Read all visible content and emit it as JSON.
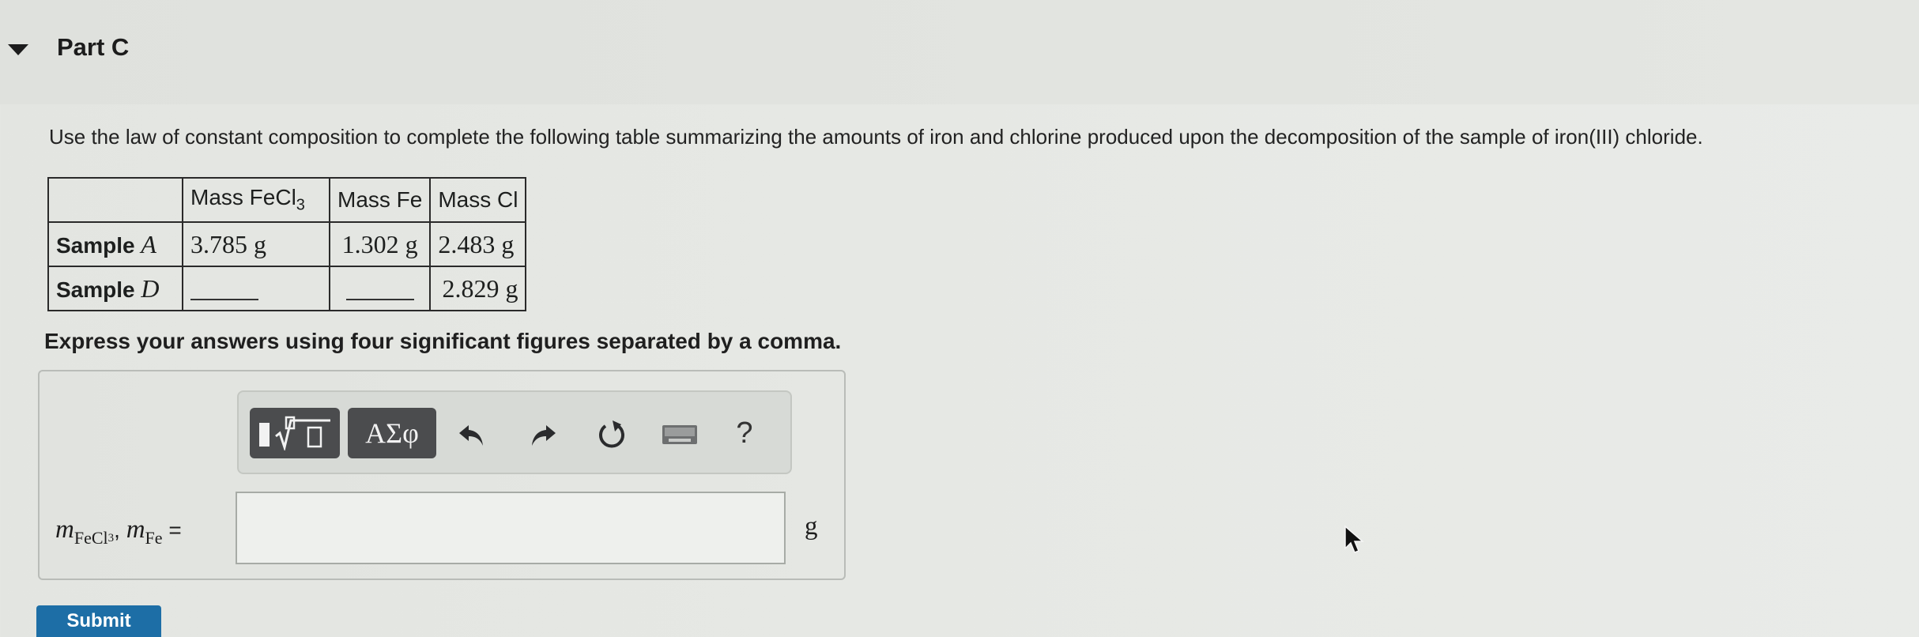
{
  "part": {
    "title": "Part C"
  },
  "question": {
    "instructions": "Use the law of constant composition to complete the following table summarizing the amounts of iron and chlorine produced upon the decomposition of the sample of iron(III) chloride.",
    "table": {
      "headers": [
        "",
        "Mass FeCl",
        "Mass Fe",
        "Mass Cl"
      ],
      "header_subscript": "3",
      "rows": [
        {
          "label": "Sample ",
          "label_var": "A",
          "values": [
            "3.785 g",
            "1.302 g",
            "2.483 g"
          ]
        },
        {
          "label": "Sample ",
          "label_var": "D",
          "values": [
            "",
            "",
            "2.829 g"
          ]
        }
      ]
    },
    "note": "Express your answers using four significant figures separated by a comma."
  },
  "answer": {
    "label_m1": "m",
    "label_sub1": "FeCl",
    "label_sub1_3": "3",
    "label_sep": ", ",
    "label_m2": "m",
    "label_sub2": "Fe",
    "label_eq": " =",
    "input_value": "",
    "unit": "g"
  },
  "toolbar": {
    "greek_label": "ΑΣφ",
    "help_label": "?"
  },
  "submit": {
    "label": "Submit"
  },
  "colors": {
    "toolbar_button": "#4b4c4e",
    "submit_button": "#1d6ea6",
    "background": "#e5e7e3"
  },
  "icons": [
    "collapse-triangle-icon",
    "templates-icon",
    "undo-icon",
    "redo-icon",
    "reset-icon",
    "keyboard-icon",
    "mouse-cursor-icon"
  ]
}
